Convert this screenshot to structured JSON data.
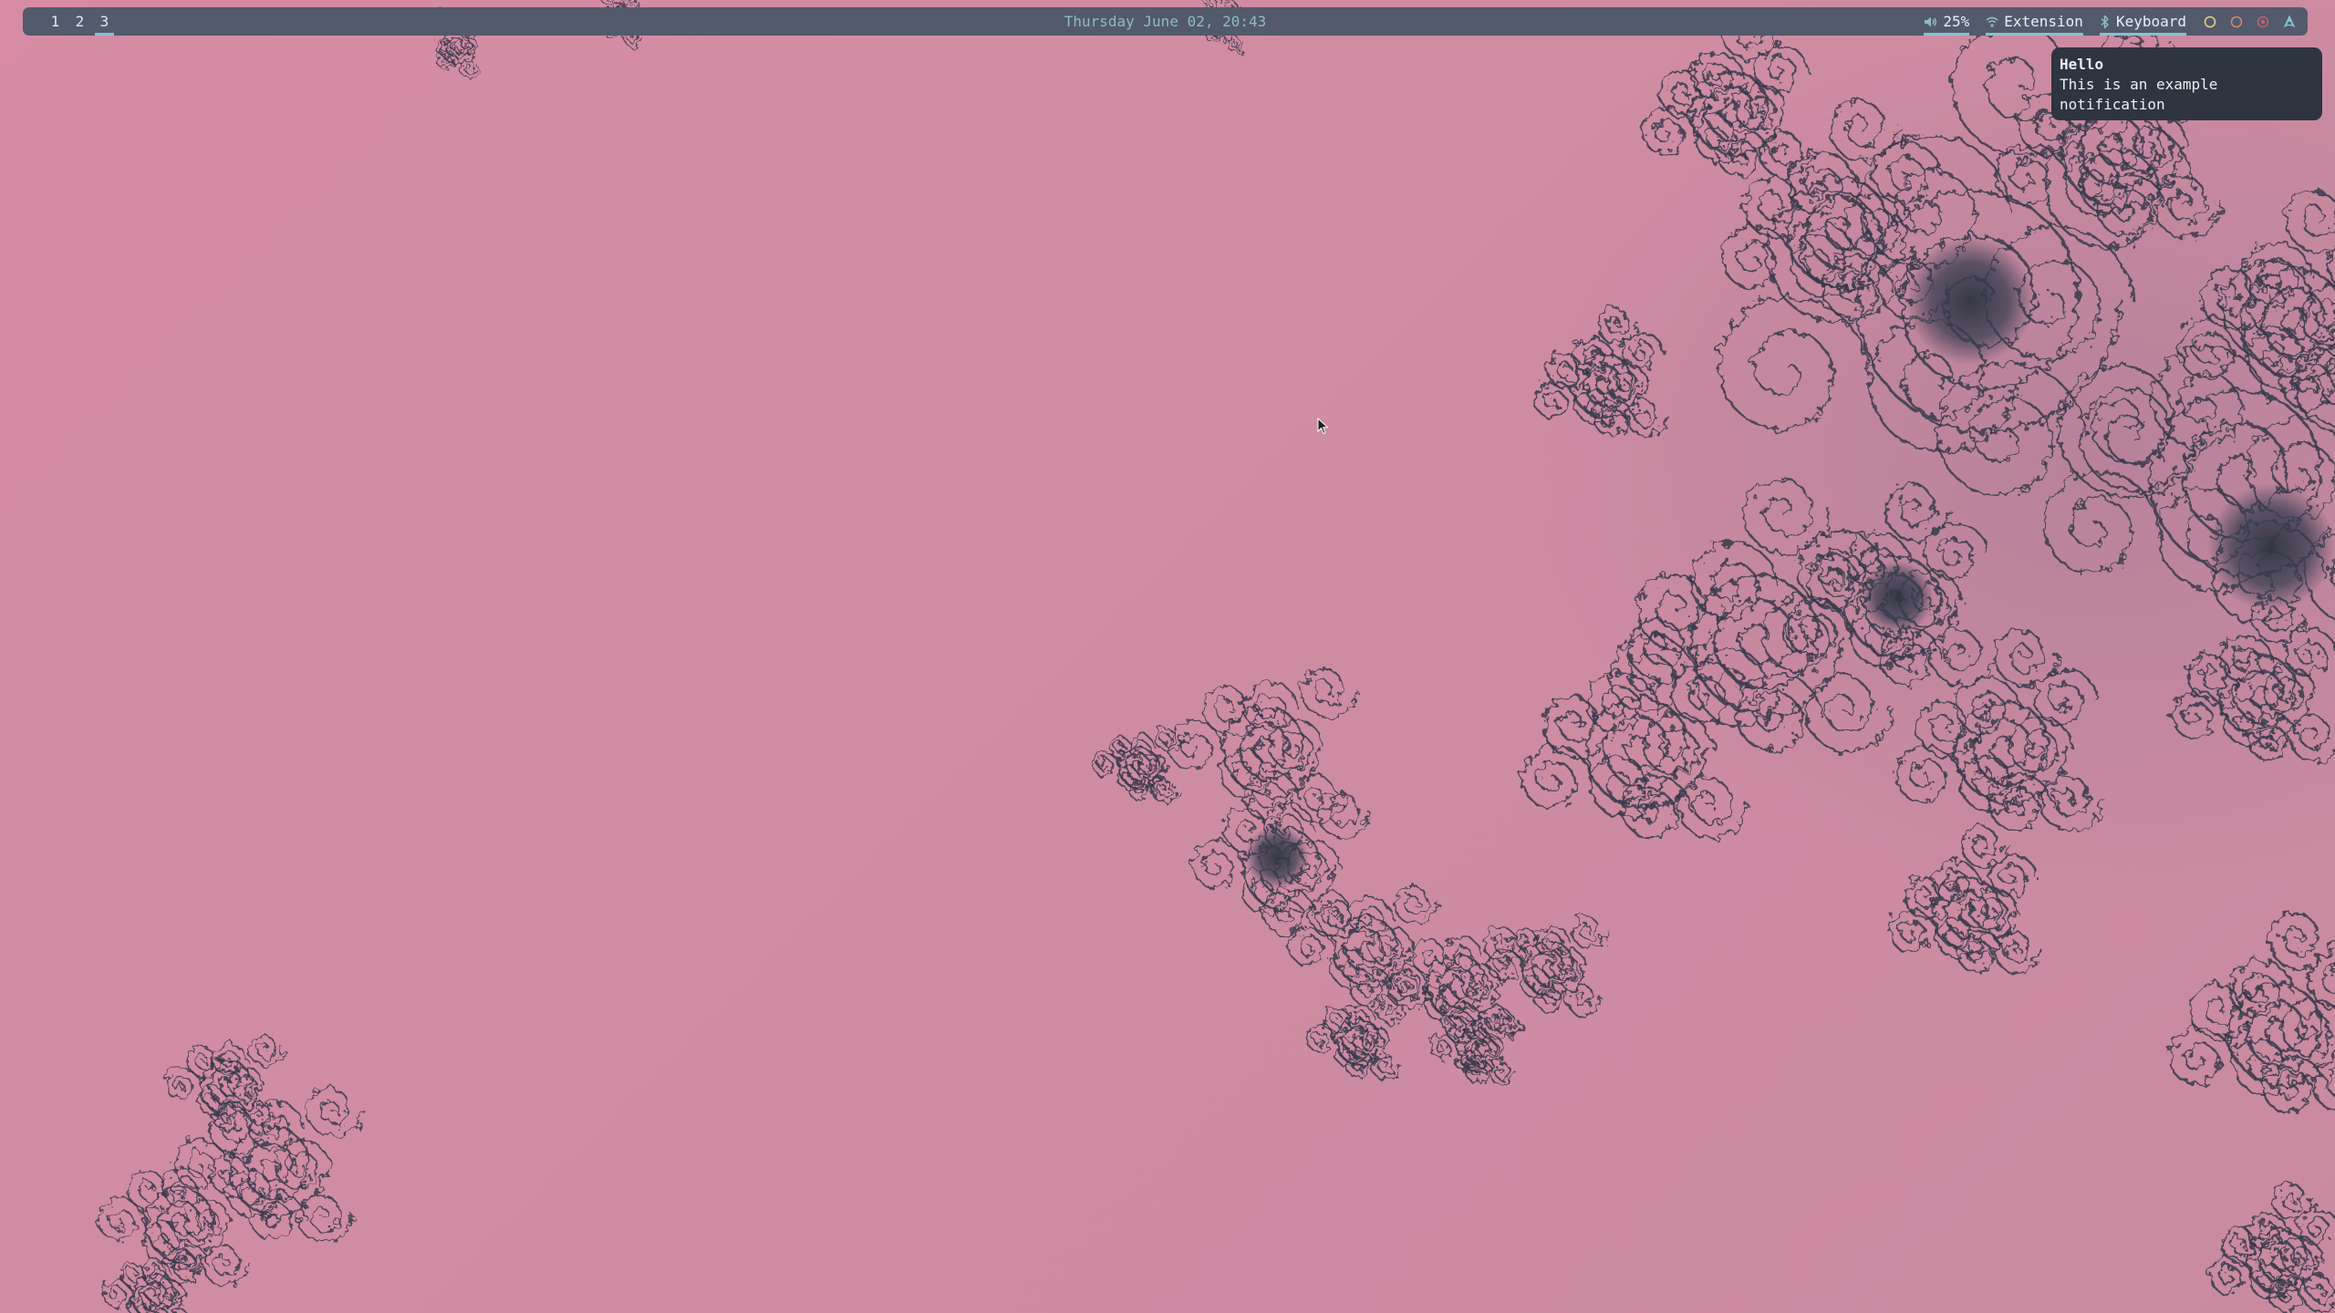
{
  "desktop": {
    "wallpaper": "julia-fractal-wallpaper",
    "background_color": "#cf8ca3",
    "fractal_color": "#2e3440"
  },
  "topbar": {
    "background_color": "#525a6b",
    "accent_color": "#88c0d0",
    "workspaces": [
      {
        "label": "1",
        "active": false
      },
      {
        "label": "2",
        "active": false
      },
      {
        "label": "3",
        "active": true
      }
    ],
    "clock": "Thursday June 02, 20:43",
    "volume": {
      "icon": "volume-icon",
      "label": "25%"
    },
    "network": {
      "icon": "wifi-icon",
      "label": "Extension"
    },
    "bluetooth": {
      "icon": "bluetooth-icon",
      "label": "Keyboard"
    },
    "tray": [
      {
        "icon": "circle-yellow-icon",
        "color": "#ebcb8b"
      },
      {
        "icon": "circle-orange-icon",
        "color": "#d08770"
      },
      {
        "icon": "record-red-icon",
        "color": "#bf616a"
      },
      {
        "icon": "arch-linux-icon",
        "color": "#88c0d0"
      }
    ]
  },
  "notification": {
    "title": "Hello",
    "body_line1": "This is an example",
    "body_line2": "notification",
    "background_color": "#2e3440"
  },
  "cursor": {
    "icon": "mouse-pointer-icon"
  }
}
